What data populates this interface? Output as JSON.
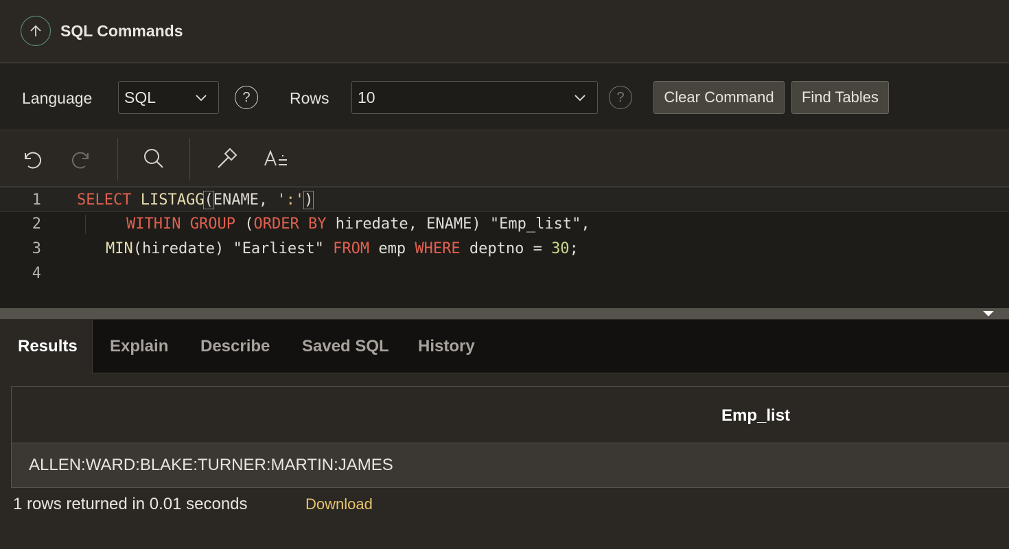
{
  "header": {
    "title": "SQL Commands"
  },
  "toolbar": {
    "language_label": "Language",
    "language_value": "SQL",
    "rows_label": "Rows",
    "rows_value": "10",
    "help_symbol": "?",
    "clear_label": "Clear Command",
    "find_label": "Find Tables"
  },
  "editor": {
    "line_numbers": [
      "1",
      "2",
      "3",
      "4"
    ]
  },
  "tabs": [
    "Results",
    "Explain",
    "Describe",
    "Saved SQL",
    "History"
  ],
  "results": {
    "column_header": "Emp_list",
    "rows": [
      "ALLEN:WARD:BLAKE:TURNER:MARTIN:JAMES"
    ],
    "status": "1 rows returned in 0.01 seconds",
    "download_label": "Download"
  },
  "colors": {
    "keyword": "#e0604f",
    "string": "#e6c27a",
    "number": "#c8d98a",
    "link": "#e8c46a",
    "accent_ring": "#5f9a7c"
  },
  "icons": [
    "arrow-up-icon",
    "chevron-down-icon",
    "help-icon",
    "undo-icon",
    "redo-icon",
    "search-icon",
    "hammer-icon",
    "text-format-icon",
    "collapse-icon"
  ]
}
